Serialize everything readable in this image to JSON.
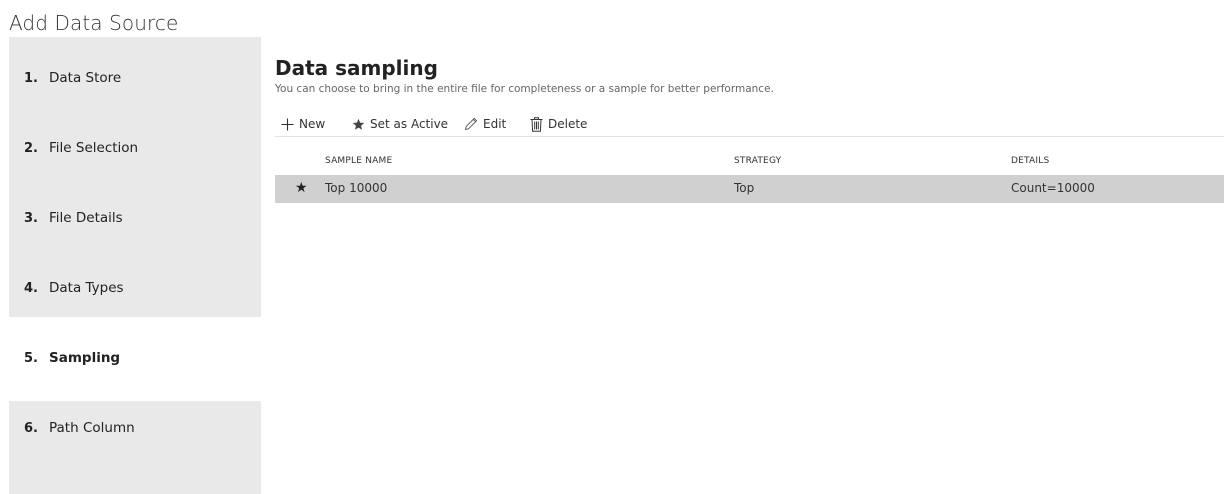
{
  "window": {
    "title": "Add Data Source"
  },
  "sidebar": {
    "steps": [
      {
        "number": "1.",
        "label": "Data Store"
      },
      {
        "number": "2.",
        "label": "File Selection"
      },
      {
        "number": "3.",
        "label": "File Details"
      },
      {
        "number": "4.",
        "label": "Data Types"
      },
      {
        "number": "5.",
        "label": "Sampling",
        "active": true
      },
      {
        "number": "6.",
        "label": "Path Column"
      }
    ]
  },
  "main": {
    "title": "Data sampling",
    "subtitle": "You can choose to bring in the entire file for completeness or a sample for better performance.",
    "toolbar": {
      "new_label": "New",
      "set_active_label": "Set as Active",
      "edit_label": "Edit",
      "delete_label": "Delete"
    },
    "table": {
      "columns": [
        "SAMPLE NAME",
        "STRATEGY",
        "DETAILS"
      ],
      "rows": [
        {
          "active_icon": "star-filled-icon",
          "sample_name": "Top 10000",
          "strategy": "Top",
          "details": "Count=10000",
          "selected": true
        }
      ]
    }
  },
  "colors": {
    "sidebar_bg": "#e9e9e9",
    "selected_row_bg": "#d0d0d0",
    "text": "#222222",
    "subtitle_text": "#666666"
  }
}
